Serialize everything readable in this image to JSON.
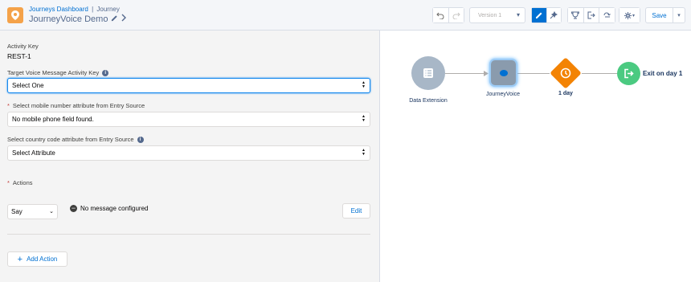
{
  "header": {
    "breadcrumb_parent": "Journeys Dashboard",
    "breadcrumb_sep": "|",
    "breadcrumb_current": "Journey",
    "title": "JourneyVoice Demo",
    "version_label": "Version 1",
    "save_label": "Save"
  },
  "form": {
    "activity_key_label": "Activity Key",
    "activity_key_value": "REST-1",
    "target_label": "Target Voice Message Activity Key",
    "target_value": "Select One",
    "mobile_label": "Select mobile number attribute from Entry Source",
    "mobile_value": "No mobile phone field found.",
    "country_label": "Select country code attribute from Entry Source",
    "country_value": "Select Attribute",
    "actions_label": "Actions",
    "action_type": "Say",
    "action_status": "No message configured",
    "edit_label": "Edit",
    "add_action_label": "Add Action"
  },
  "canvas": {
    "nodes": [
      {
        "label": "Data Extension",
        "color": "#a8b7c7"
      },
      {
        "label": "JourneyVoice",
        "color": "#8a9bad"
      },
      {
        "label": "1 day",
        "color": "#f38303"
      },
      {
        "label": "Exit on day 1",
        "color": "#4bca81"
      }
    ]
  },
  "colors": {
    "brand": "#0070d2",
    "app_icon": "#f4a24a"
  }
}
